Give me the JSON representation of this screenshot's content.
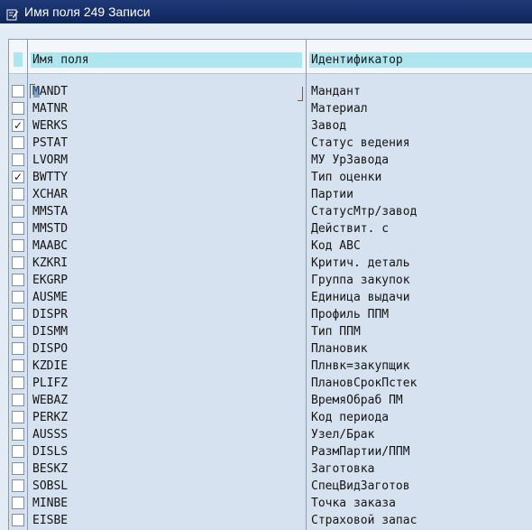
{
  "window": {
    "title": "Имя поля 249 Записи"
  },
  "table": {
    "col1_header": "Имя поля",
    "col2_header": "Идентификатор",
    "rows": [
      {
        "name": "MANDT",
        "id": "Мандант",
        "checked": false
      },
      {
        "name": "MATNR",
        "id": "Материал",
        "checked": false
      },
      {
        "name": "WERKS",
        "id": "Завод",
        "checked": true
      },
      {
        "name": "PSTAT",
        "id": "Статус ведения",
        "checked": false
      },
      {
        "name": "LVORM",
        "id": "МУ УрЗавода",
        "checked": false
      },
      {
        "name": "BWTTY",
        "id": "Тип оценки",
        "checked": true
      },
      {
        "name": "XCHAR",
        "id": "Партии",
        "checked": false
      },
      {
        "name": "MMSTA",
        "id": "СтатусМтр/завод",
        "checked": false
      },
      {
        "name": "MMSTD",
        "id": "Действит. с",
        "checked": false
      },
      {
        "name": "MAABC",
        "id": "Код ABC",
        "checked": false
      },
      {
        "name": "KZKRI",
        "id": "Критич. деталь",
        "checked": false
      },
      {
        "name": "EKGRP",
        "id": "Группа закупок",
        "checked": false
      },
      {
        "name": "AUSME",
        "id": "Единица выдачи",
        "checked": false
      },
      {
        "name": "DISPR",
        "id": "Профиль ППМ",
        "checked": false
      },
      {
        "name": "DISMM",
        "id": "Тип ППМ",
        "checked": false
      },
      {
        "name": "DISPO",
        "id": "Плановик",
        "checked": false
      },
      {
        "name": "KZDIE",
        "id": "Плнвк=закупщик",
        "checked": false
      },
      {
        "name": "PLIFZ",
        "id": "ПлановСрокПстек",
        "checked": false
      },
      {
        "name": "WEBAZ",
        "id": "ВремяОбраб ПМ",
        "checked": false
      },
      {
        "name": "PERKZ",
        "id": "Код периода",
        "checked": false
      },
      {
        "name": "AUSSS",
        "id": "Узел/Брак",
        "checked": false
      },
      {
        "name": "DISLS",
        "id": "РазмПартии/ППМ",
        "checked": false
      },
      {
        "name": "BESKZ",
        "id": "Заготовка",
        "checked": false
      },
      {
        "name": "SOBSL",
        "id": "СпецВидЗаготов",
        "checked": false
      },
      {
        "name": "MINBE",
        "id": "Точка заказа",
        "checked": false
      },
      {
        "name": "EISBE",
        "id": "Страховой запас",
        "checked": false
      }
    ]
  },
  "icons": {
    "title_icon": "edit-window-icon",
    "check_mark": "✓"
  }
}
